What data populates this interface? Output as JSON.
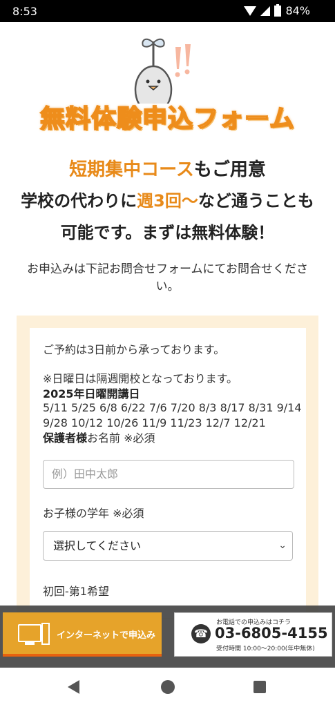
{
  "status": {
    "time": "8:53",
    "battery": "84%"
  },
  "hero": {
    "title": "無料体験申込フォーム",
    "sub1_orange": "短期集中コース",
    "sub1_rest": "もご用意",
    "sub2_a": "学校の代わりに",
    "sub2_orange": "週3回〜",
    "sub2_b": "など通うことも可能です。まずは無料体験！",
    "intro": "お申込みは下記お問合せフォームにてお問合せください。"
  },
  "form": {
    "note1": "ご予約は3日前から承っております。",
    "note2": "※日曜日は隔週開校となっております。",
    "sunday_heading": "2025年日曜開講日",
    "sunday_dates": "5/11 5/25 6/8 6/22 7/6 7/20 8/3 8/17 8/31 9/14 9/28 10/12 10/26 11/9 11/23 12/7 12/21",
    "guardian_bold": "保護者様",
    "guardian_rest": "お名前 ※必須",
    "name_placeholder": "例）田中太郎",
    "grade_label": "お子様の学年 ※必須",
    "grade_select": "選択してください",
    "first_choice_label": "初回-第1希望"
  },
  "bottom": {
    "internet_label": "インターネットで申込み",
    "tel_small": "お電話での申込みはコチラ",
    "tel_number": "03-6805-4155",
    "tel_hours": "受付時間 10:00〜20:00(年中無休)"
  }
}
